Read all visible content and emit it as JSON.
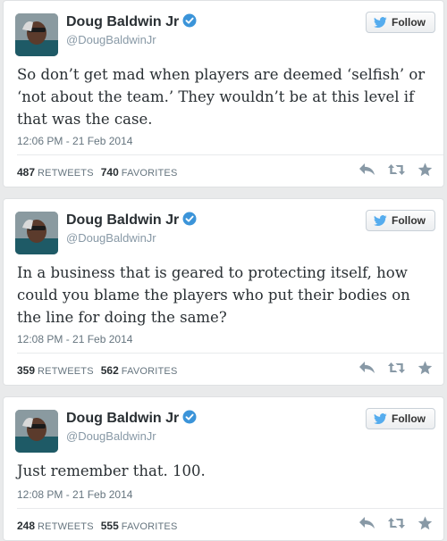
{
  "colors": {
    "accent": "#55acee",
    "verified": "#3b94d9",
    "text": "#292f33",
    "muted": "#66757f"
  },
  "tweets": [
    {
      "name": "Doug Baldwin Jr",
      "handle": "@DougBaldwinJr",
      "follow_label": "Follow",
      "text": "So don’t get mad when players are deemed ‘selfish’ or ‘not about the team.’ They wouldn’t be at this level if that was the case.",
      "timestamp": "12:06 PM - 21 Feb 2014",
      "retweets": "487",
      "retweets_label": "RETWEETS",
      "favorites": "740",
      "favorites_label": "FAVORITES",
      "icons": [
        "reply-icon",
        "retweet-icon",
        "favorite-icon"
      ]
    },
    {
      "name": "Doug Baldwin Jr",
      "handle": "@DougBaldwinJr",
      "follow_label": "Follow",
      "text": "In a business that is geared to protecting itself, how could you blame the players who put their bodies on the line for doing the same?",
      "timestamp": "12:08 PM - 21 Feb 2014",
      "retweets": "359",
      "retweets_label": "RETWEETS",
      "favorites": "562",
      "favorites_label": "FAVORITES",
      "icons": [
        "reply-icon",
        "retweet-icon",
        "favorite-icon"
      ]
    },
    {
      "name": "Doug Baldwin Jr",
      "handle": "@DougBaldwinJr",
      "follow_label": "Follow",
      "text": "Just remember that. 100.",
      "timestamp": "12:08 PM - 21 Feb 2014",
      "retweets": "248",
      "retweets_label": "RETWEETS",
      "favorites": "555",
      "favorites_label": "FAVORITES",
      "icons": [
        "reply-icon",
        "retweet-icon",
        "favorite-icon"
      ]
    }
  ]
}
